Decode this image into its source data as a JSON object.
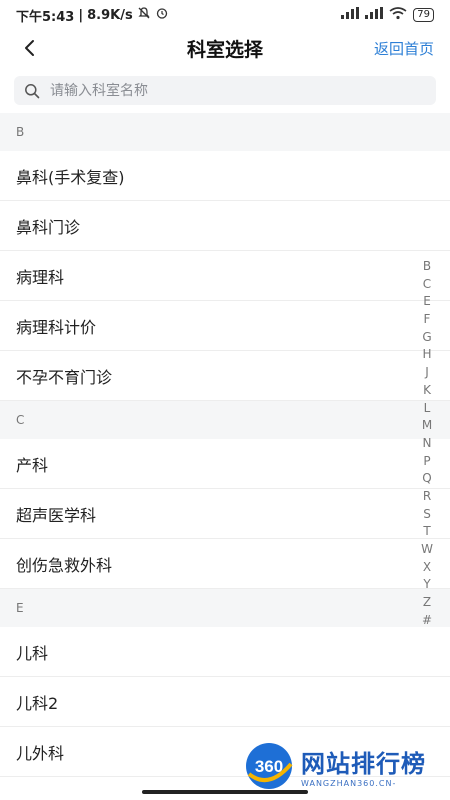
{
  "status": {
    "time": "下午5:43",
    "speed": "8.9K/s",
    "battery": "79"
  },
  "nav": {
    "title": "科室选择",
    "home_link": "返回首页"
  },
  "search": {
    "placeholder": "请输入科室名称",
    "value": ""
  },
  "groups": [
    {
      "letter": "B",
      "items": [
        "鼻科(手术复查)",
        "鼻科门诊",
        "病理科",
        "病理科计价",
        "不孕不育门诊"
      ]
    },
    {
      "letter": "C",
      "items": [
        "产科",
        "超声医学科",
        "创伤急救外科"
      ]
    },
    {
      "letter": "E",
      "items": [
        "儿科",
        "儿科2",
        "儿外科"
      ]
    }
  ],
  "index": [
    "B",
    "C",
    "E",
    "F",
    "G",
    "H",
    "J",
    "K",
    "L",
    "M",
    "N",
    "P",
    "Q",
    "R",
    "S",
    "T",
    "W",
    "X",
    "Y",
    "Z",
    "#"
  ],
  "watermark": {
    "logo": "360",
    "main": "网站排行榜",
    "sub": "WANGZHAN360.CN-"
  },
  "colors": {
    "accent": "#2d7fd6",
    "header_bg": "#f5f6f7",
    "search_bg": "#f2f3f5"
  }
}
